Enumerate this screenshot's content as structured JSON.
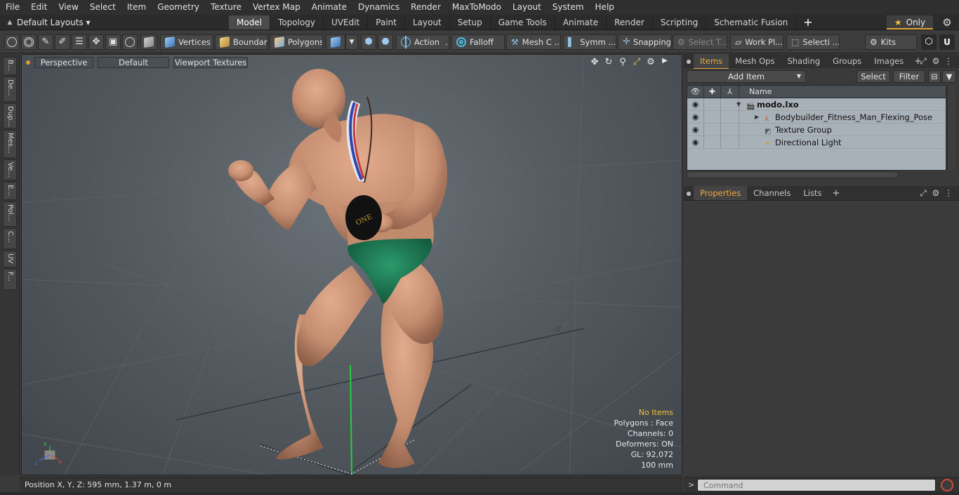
{
  "menu": [
    "File",
    "Edit",
    "View",
    "Select",
    "Item",
    "Geometry",
    "Texture",
    "Vertex Map",
    "Animate",
    "Dynamics",
    "Render",
    "MaxToModo",
    "Layout",
    "System",
    "Help"
  ],
  "layouts": {
    "label": "Default Layouts ▾"
  },
  "tabs": [
    "Model",
    "Topology",
    "UVEdit",
    "Paint",
    "Layout",
    "Setup",
    "Game Tools",
    "Animate",
    "Render",
    "Scripting",
    "Schematic Fusion"
  ],
  "active_tab": "Model",
  "only_label": "Only",
  "toolbar": {
    "vertices": "Vertices",
    "boundary": "Boundary",
    "polygons": "Polygons",
    "action": "Action",
    "falloff": "Falloff",
    "mesh": "Mesh C ...",
    "symmetry": "Symm ...",
    "snapping": "Snapping",
    "select_t": "Select T...",
    "work_plane": "Work Pl...",
    "selection": "Selecti ...",
    "kits": "Kits"
  },
  "left_tabs": [
    "B...",
    "De...",
    "Dup...",
    "Mes...",
    "Ve...",
    "E...",
    "Pol...",
    "C...",
    "UV",
    "F..."
  ],
  "viewport": {
    "view": "Perspective",
    "shading": "Default",
    "textures": "Viewport Textures",
    "info": {
      "status": "No Items",
      "polygons": "Polygons : Face",
      "channels": "Channels: 0",
      "deformers": "Deformers: ON",
      "gl": "GL: 92,072",
      "scale": "100 mm"
    },
    "axis_label": "-Z"
  },
  "statusbar": {
    "position": "Position X, Y, Z:   595 mm, 1.37 m, 0 m"
  },
  "items_panel": {
    "tabs": [
      "Items",
      "Mesh Ops",
      "Shading",
      "Groups",
      "Images"
    ],
    "active": "Items",
    "add_item": "Add Item",
    "select": "Select",
    "filter": "Filter",
    "column_name": "Name",
    "rows": [
      {
        "name": "modo.lxo",
        "type": "scene"
      },
      {
        "name": "Bodybuilder_Fitness_Man_Flexing_Pose",
        "type": "mesh"
      },
      {
        "name": "Texture Group",
        "type": "texture"
      },
      {
        "name": "Directional Light",
        "type": "light"
      }
    ]
  },
  "properties_panel": {
    "tabs": [
      "Properties",
      "Channels",
      "Lists"
    ],
    "active": "Properties"
  },
  "command": {
    "placeholder": "Command"
  },
  "colors": {
    "accent": "#f2a83b",
    "skin": "#c99275",
    "trunks": "#1f7a55",
    "axis_green": "#22d040"
  }
}
